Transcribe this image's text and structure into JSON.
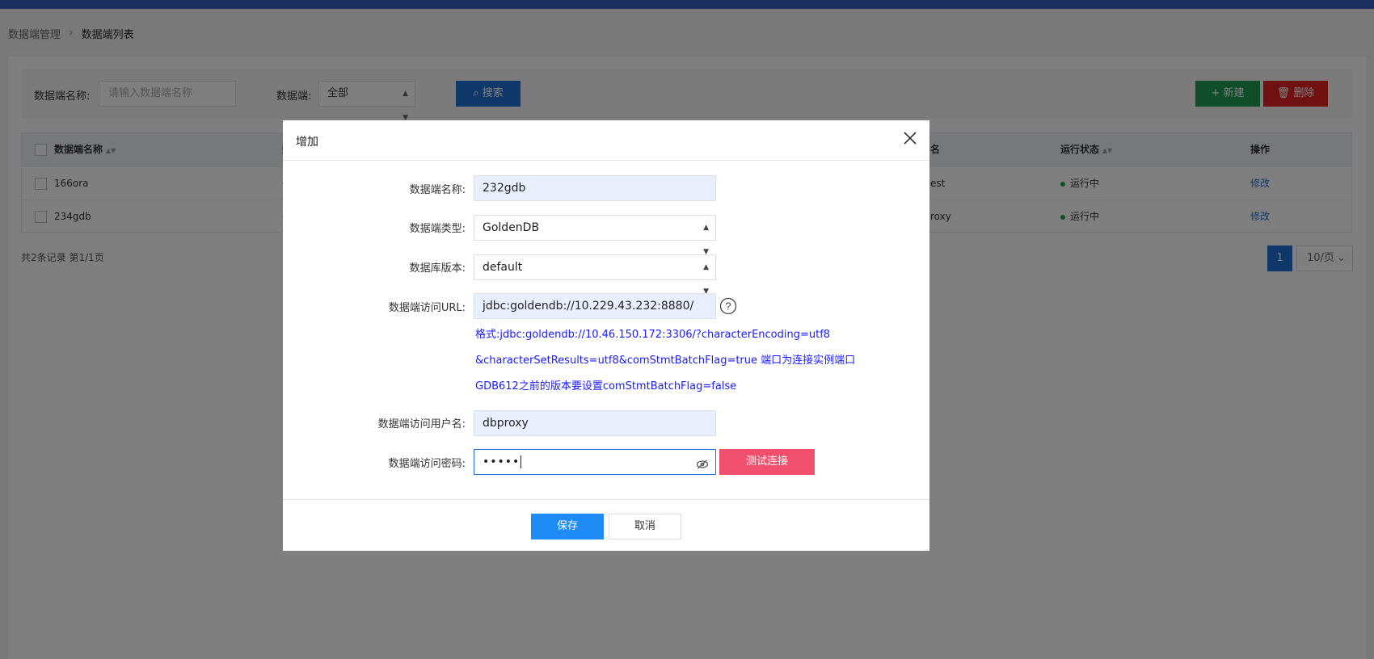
{
  "breadcrumb": {
    "parent": "数据端管理",
    "current": "数据端列表"
  },
  "filter": {
    "name_label": "数据端名称:",
    "name_placeholder": "请输入数据端名称",
    "type_label": "数据端:",
    "type_value": "全部",
    "search_label": "搜索",
    "new_label": "新建",
    "delete_label": "删除"
  },
  "table": {
    "headers": {
      "name": "数据端名称",
      "username": "名",
      "status": "运行状态",
      "actions": "操作"
    },
    "rows": [
      {
        "name": "166ora",
        "col2": "C",
        "username": "est",
        "status": "运行中",
        "action": "修改"
      },
      {
        "name": "234gdb",
        "col2": "C",
        "username": "roxy",
        "status": "运行中",
        "action": "修改"
      }
    ],
    "col2_header": "数"
  },
  "pagination": {
    "total_text": "共2条记录 第1/1页",
    "current_page": "1",
    "page_size": "10/页"
  },
  "modal": {
    "title": "增加",
    "fields": {
      "name": {
        "label": "数据端名称:",
        "value": "232gdb"
      },
      "type": {
        "label": "数据端类型:",
        "value": "GoldenDB"
      },
      "version": {
        "label": "数据库版本:",
        "value": "default"
      },
      "url": {
        "label": "数据端访问URL:",
        "value": "jdbc:goldendb://10.229.43.232:8880/"
      },
      "username": {
        "label": "数据端访问用户名:",
        "value": "dbproxy"
      },
      "password": {
        "label": "数据端访问密码:",
        "value": "•••••"
      }
    },
    "hints": [
      "格式:jdbc:goldendb://10.46.150.172:3306/?characterEncoding=utf8",
      "&characterSetResults=utf8&comStmtBatchFlag=true 端口为连接实例端口",
      "GDB612之前的版本要设置comStmtBatchFlag=false"
    ],
    "test_label": "测试连接",
    "save_label": "保存",
    "cancel_label": "取消"
  },
  "colors": {
    "primary": "#1f6fd4",
    "success": "#1e9c50",
    "danger": "#e02020",
    "test": "#f0506e",
    "hint": "#1a1aff"
  }
}
